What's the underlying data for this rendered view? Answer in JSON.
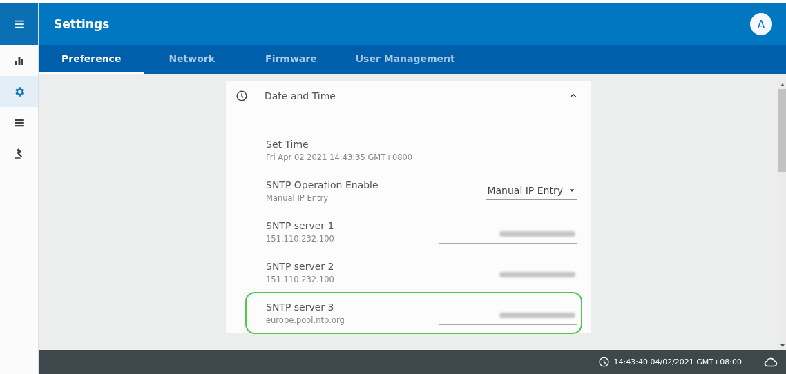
{
  "header": {
    "title": "Settings",
    "avatar": "A"
  },
  "sidebar": {
    "items": [
      {
        "selected": false
      },
      {
        "selected": true
      },
      {
        "selected": false
      },
      {
        "selected": false
      }
    ]
  },
  "tabs": [
    {
      "label": "Preference",
      "selected": true
    },
    {
      "label": "Network",
      "selected": false
    },
    {
      "label": "Firmware",
      "selected": false
    },
    {
      "label": "User Management",
      "selected": false
    }
  ],
  "section": {
    "title": "Date and Time",
    "expanded": true,
    "rows": [
      {
        "kind": "text",
        "label": "Set Time",
        "value": "Fri Apr 02 2021 14:43:35 GMT+0800",
        "highlighted": false
      },
      {
        "kind": "select",
        "label": "SNTP Operation Enable",
        "value": "Manual IP Entry",
        "selection": "Manual IP Entry",
        "highlighted": false
      },
      {
        "kind": "field",
        "label": "SNTP server 1",
        "value": "151.110.232.100",
        "highlighted": false
      },
      {
        "kind": "field",
        "label": "SNTP server 2",
        "value": "151.110.232.100",
        "highlighted": false
      },
      {
        "kind": "field",
        "label": "SNTP server 3",
        "value": "europe.pool.ntp.org",
        "highlighted": true
      }
    ]
  },
  "status_bar": {
    "clock": "14:43:40 04/02/2021 GMT+08:00"
  }
}
